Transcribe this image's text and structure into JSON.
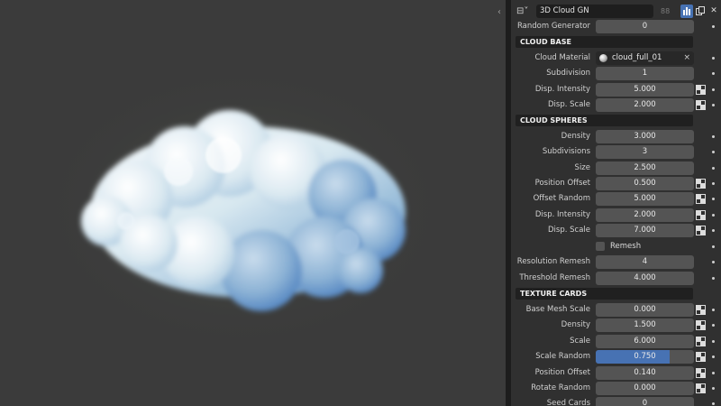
{
  "viewport": {
    "collapse_glyph": "‹"
  },
  "toolbar": {
    "node_icon": "node-tree-icon",
    "nodegroup_name": "3D Cloud GN",
    "users_count": "88",
    "fake_user_icon": "fake-user-icon",
    "duplicate_icon": "duplicate-icon",
    "unlink_icon": "close-icon"
  },
  "rows": {
    "random_generator": {
      "label": "Random Generator",
      "value": "0"
    },
    "cloud_base_header": "CLOUD BASE",
    "cloud_material": {
      "label": "Cloud Material",
      "value": "cloud_full_01",
      "clear": "×"
    },
    "subdivision": {
      "label": "Subdivision",
      "value": "1"
    },
    "base_disp_intensity": {
      "label": "Disp. Intensity",
      "value": "5.000"
    },
    "base_disp_scale": {
      "label": "Disp. Scale",
      "value": "2.000"
    },
    "cloud_spheres_header": "CLOUD SPHERES",
    "density": {
      "label": "Density",
      "value": "3.000"
    },
    "subdivisions": {
      "label": "Subdivisions",
      "value": "3"
    },
    "size": {
      "label": "Size",
      "value": "2.500"
    },
    "position_offset": {
      "label": "Position Offset",
      "value": "0.500"
    },
    "offset_random": {
      "label": "Offset Random",
      "value": "5.000"
    },
    "spheres_disp_intensity": {
      "label": "Disp. Intensity",
      "value": "2.000"
    },
    "spheres_disp_scale": {
      "label": "Disp. Scale",
      "value": "7.000"
    },
    "remesh": {
      "label": "Remesh",
      "checked": false
    },
    "resolution_remesh": {
      "label": "Resolution Remesh",
      "value": "4"
    },
    "threshold_remesh": {
      "label": "Threshold Remesh",
      "value": "4.000"
    },
    "texture_cards_header": "TEXTURE CARDS",
    "base_mesh_scale": {
      "label": "Base Mesh Scale",
      "value": "0.000"
    },
    "tc_density": {
      "label": "Density",
      "value": "1.500"
    },
    "scale": {
      "label": "Scale",
      "value": "6.000"
    },
    "scale_random": {
      "label": "Scale Random",
      "value": "0.750",
      "fill_fraction": 0.75
    },
    "tc_position_offset": {
      "label": "Position Offset",
      "value": "0.140"
    },
    "rotate_random": {
      "label": "Rotate Random",
      "value": "0.000"
    },
    "seed_cards": {
      "label": "Seed Cards",
      "value": "0"
    }
  },
  "icons": {
    "uv": "texture-uv-icon",
    "keyframe_dot": "keyframe-dot-icon",
    "material": "material-sphere-icon",
    "cloud": "cloud-render-image"
  },
  "colors": {
    "accent": "#4772b3",
    "panel_bg": "#303030",
    "field_bg": "#545454",
    "header_bg": "#202020",
    "viewport_bg": "#3b3b3b"
  }
}
